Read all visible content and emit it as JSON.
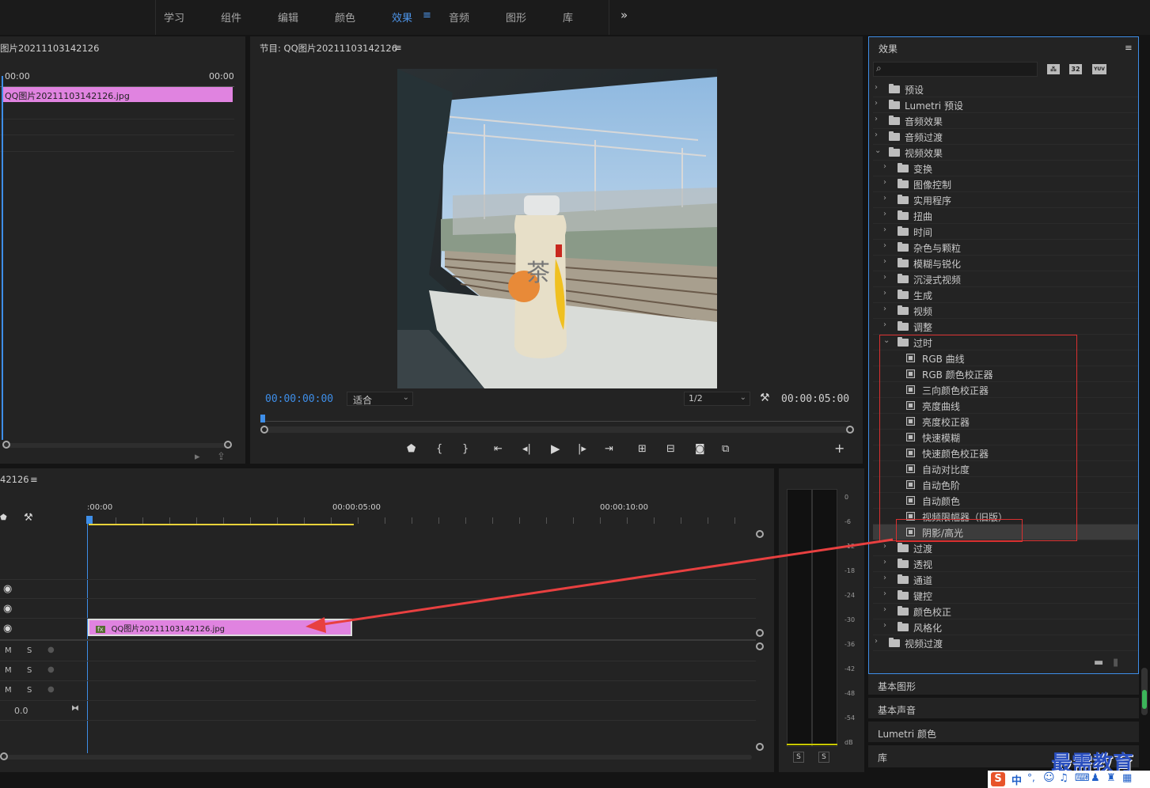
{
  "workspaces": [
    {
      "label": "学习"
    },
    {
      "label": "组件"
    },
    {
      "label": "编辑"
    },
    {
      "label": "颜色"
    },
    {
      "label": "效果",
      "active": true
    },
    {
      "label": "音频"
    },
    {
      "label": "图形"
    },
    {
      "label": "库"
    }
  ],
  "workspace_menu_icon": "≡",
  "more_icon": "»",
  "source": {
    "title": "图片20211103142126",
    "tc_left": "00:00",
    "tc_right": "00:00",
    "clip": "QQ图片20211103142126.jpg"
  },
  "program": {
    "title": "节目: QQ图片20211103142126",
    "menu": "≡",
    "timecode": "00:00:00:00",
    "zoom": "适合",
    "resolution": "1/2",
    "duration": "00:00:05:00"
  },
  "timeline": {
    "title": "42126",
    "menu": "≡",
    "ruler": [
      ":00:00",
      "00:00:05:00",
      "00:00:10:00"
    ],
    "clip": "QQ图片20211103142126.jpg",
    "clip_badge": "fx",
    "audio_volume": "0.0",
    "m_label": "M",
    "s_label": "S"
  },
  "meter": {
    "ticks": [
      "0",
      "-6",
      "-12",
      "-18",
      "-24",
      "-30",
      "-36",
      "-42",
      "-48",
      "-54",
      "dB"
    ],
    "solo": [
      "S",
      "S"
    ]
  },
  "effects": {
    "title": "效果",
    "menu": "≡",
    "search_placeholder": "",
    "badges": [
      "32",
      "YUV"
    ],
    "tree": [
      {
        "label": "预设",
        "level": 0,
        "state": "closed",
        "kind": "preset"
      },
      {
        "label": "Lumetri 预设",
        "level": 0,
        "state": "closed",
        "kind": "preset"
      },
      {
        "label": "音频效果",
        "level": 0,
        "state": "closed",
        "kind": "folder"
      },
      {
        "label": "音频过渡",
        "level": 0,
        "state": "closed",
        "kind": "folder"
      },
      {
        "label": "视频效果",
        "level": 0,
        "state": "open",
        "kind": "folder"
      },
      {
        "label": "变换",
        "level": 1,
        "state": "closed",
        "kind": "folder"
      },
      {
        "label": "图像控制",
        "level": 1,
        "state": "closed",
        "kind": "folder"
      },
      {
        "label": "实用程序",
        "level": 1,
        "state": "closed",
        "kind": "folder"
      },
      {
        "label": "扭曲",
        "level": 1,
        "state": "closed",
        "kind": "folder"
      },
      {
        "label": "时间",
        "level": 1,
        "state": "closed",
        "kind": "folder"
      },
      {
        "label": "杂色与颗粒",
        "level": 1,
        "state": "closed",
        "kind": "folder"
      },
      {
        "label": "模糊与锐化",
        "level": 1,
        "state": "closed",
        "kind": "folder"
      },
      {
        "label": "沉浸式视频",
        "level": 1,
        "state": "closed",
        "kind": "folder"
      },
      {
        "label": "生成",
        "level": 1,
        "state": "closed",
        "kind": "folder"
      },
      {
        "label": "视频",
        "level": 1,
        "state": "closed",
        "kind": "folder"
      },
      {
        "label": "调整",
        "level": 1,
        "state": "closed",
        "kind": "folder"
      },
      {
        "label": "过时",
        "level": 1,
        "state": "open",
        "kind": "folder"
      },
      {
        "label": "RGB 曲线",
        "level": 2,
        "kind": "effect"
      },
      {
        "label": "RGB 颜色校正器",
        "level": 2,
        "kind": "effect"
      },
      {
        "label": "三向颜色校正器",
        "level": 2,
        "kind": "effect"
      },
      {
        "label": "亮度曲线",
        "level": 2,
        "kind": "effect"
      },
      {
        "label": "亮度校正器",
        "level": 2,
        "kind": "effect"
      },
      {
        "label": "快速模糊",
        "level": 2,
        "kind": "effect"
      },
      {
        "label": "快速颜色校正器",
        "level": 2,
        "kind": "effect"
      },
      {
        "label": "自动对比度",
        "level": 2,
        "kind": "effect"
      },
      {
        "label": "自动色阶",
        "level": 2,
        "kind": "effect"
      },
      {
        "label": "自动颜色",
        "level": 2,
        "kind": "effect"
      },
      {
        "label": "视频限幅器（旧版）",
        "level": 2,
        "kind": "effect"
      },
      {
        "label": "阴影/高光",
        "level": 2,
        "kind": "effect",
        "selected": true
      },
      {
        "label": "过渡",
        "level": 1,
        "state": "closed",
        "kind": "folder"
      },
      {
        "label": "透视",
        "level": 1,
        "state": "closed",
        "kind": "folder"
      },
      {
        "label": "通道",
        "level": 1,
        "state": "closed",
        "kind": "folder"
      },
      {
        "label": "键控",
        "level": 1,
        "state": "closed",
        "kind": "folder"
      },
      {
        "label": "颜色校正",
        "level": 1,
        "state": "closed",
        "kind": "folder"
      },
      {
        "label": "风格化",
        "level": 1,
        "state": "closed",
        "kind": "folder"
      },
      {
        "label": "视频过渡",
        "level": 0,
        "state": "closed",
        "kind": "folder"
      }
    ]
  },
  "collapsed_panels": [
    "基本图形",
    "基本声音",
    "Lumetri 颜色",
    "库"
  ],
  "watermark": "最需教育",
  "ime": {
    "label": "中"
  },
  "colors": {
    "accent": "#3e8ee8",
    "clip": "#e083e0",
    "highlight_box": "#d93030",
    "arrow": "#e84040",
    "playhead": "#3e8ee8"
  }
}
